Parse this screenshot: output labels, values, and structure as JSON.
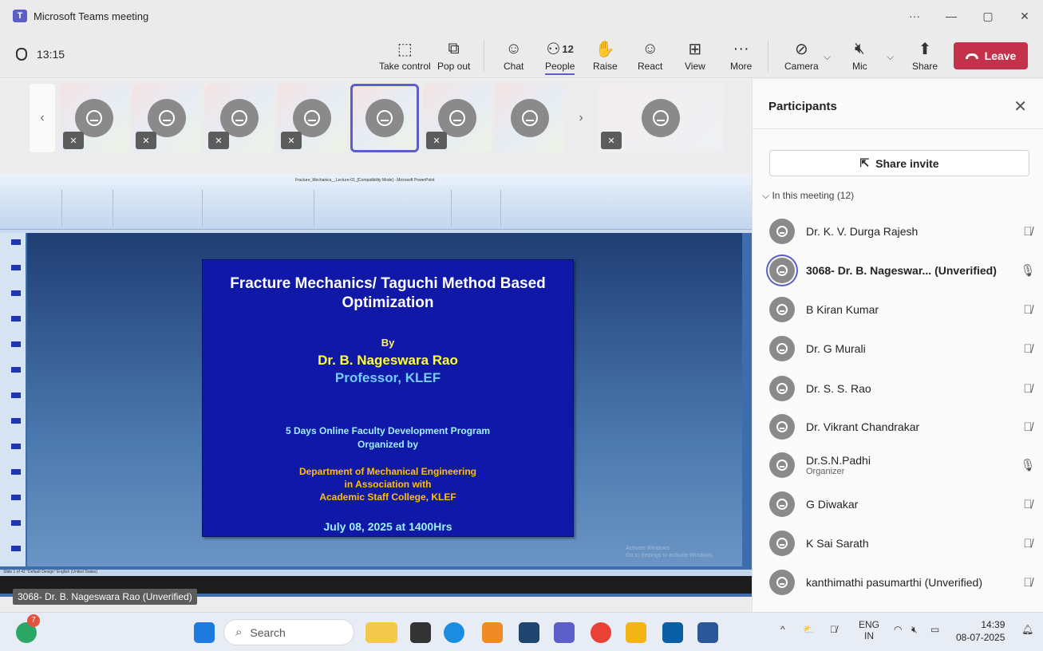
{
  "window": {
    "title": "Microsoft Teams meeting",
    "controls": [
      "···",
      "—",
      "▢",
      "✕"
    ]
  },
  "toolbar": {
    "timer": "13:15",
    "take_control": "Take control",
    "pop_out": "Pop out",
    "chat": "Chat",
    "people": "People",
    "people_count": "12",
    "raise": "Raise",
    "react": "React",
    "view": "View",
    "more": "More",
    "camera": "Camera",
    "mic": "Mic",
    "share": "Share",
    "leave": "Leave"
  },
  "colors": {
    "accent": "#5b5fc7",
    "leave": "#c4314b",
    "slide_bg": "#0f18a7"
  },
  "shared_screen": {
    "ppt_title": "Fracture_Mechanics__Lecture-01_[Compatibility Mode] - Microsoft PowerPoint",
    "slide": {
      "title": "Fracture Mechanics/ Taguchi Method Based Optimization",
      "by": "By",
      "author": "Dr. B. Nageswara Rao",
      "designation": "Professor, KLEF",
      "program": "5 Days Online Faculty Development Program",
      "organized": "Organized by",
      "dept": "Department of Mechanical Engineering",
      "assoc": "in Association with",
      "college": "Academic Staff College, KLEF",
      "date": "July 08, 2025 at 1400Hrs"
    },
    "activate_line1": "Activate Windows",
    "activate_line2": "Go to Settings to activate Windows.",
    "status": "Slide 1 of 42   \"Default Design\"   English (United States)",
    "presenter_label": "3068- Dr. B. Nageswara Rao (Unverified)"
  },
  "panel": {
    "title": "Participants",
    "share_invite": "Share invite",
    "section": "In this meeting (12)",
    "participants": [
      {
        "name": "Dr. K. V. Durga Rajesh",
        "role": "",
        "mic": "muted"
      },
      {
        "name": "3068- Dr. B. Nageswar... (Unverified)",
        "role": "",
        "mic": "on"
      },
      {
        "name": "B Kiran Kumar",
        "role": "",
        "mic": "muted"
      },
      {
        "name": "Dr. G Murali",
        "role": "",
        "mic": "muted"
      },
      {
        "name": "Dr. S. S. Rao",
        "role": "",
        "mic": "muted"
      },
      {
        "name": "Dr. Vikrant Chandrakar",
        "role": "",
        "mic": "muted"
      },
      {
        "name": "Dr.S.N.Padhi",
        "role": "Organizer",
        "mic": "on"
      },
      {
        "name": "G Diwakar",
        "role": "",
        "mic": "muted"
      },
      {
        "name": "K Sai Sarath",
        "role": "",
        "mic": "muted"
      },
      {
        "name": "kanthimathi pasumarthi (Unverified)",
        "role": "",
        "mic": "muted"
      }
    ]
  },
  "taskbar": {
    "search": "Search",
    "lang1": "ENG",
    "lang2": "IN",
    "time": "14:39",
    "date": "08-07-2025",
    "notif": "7"
  }
}
